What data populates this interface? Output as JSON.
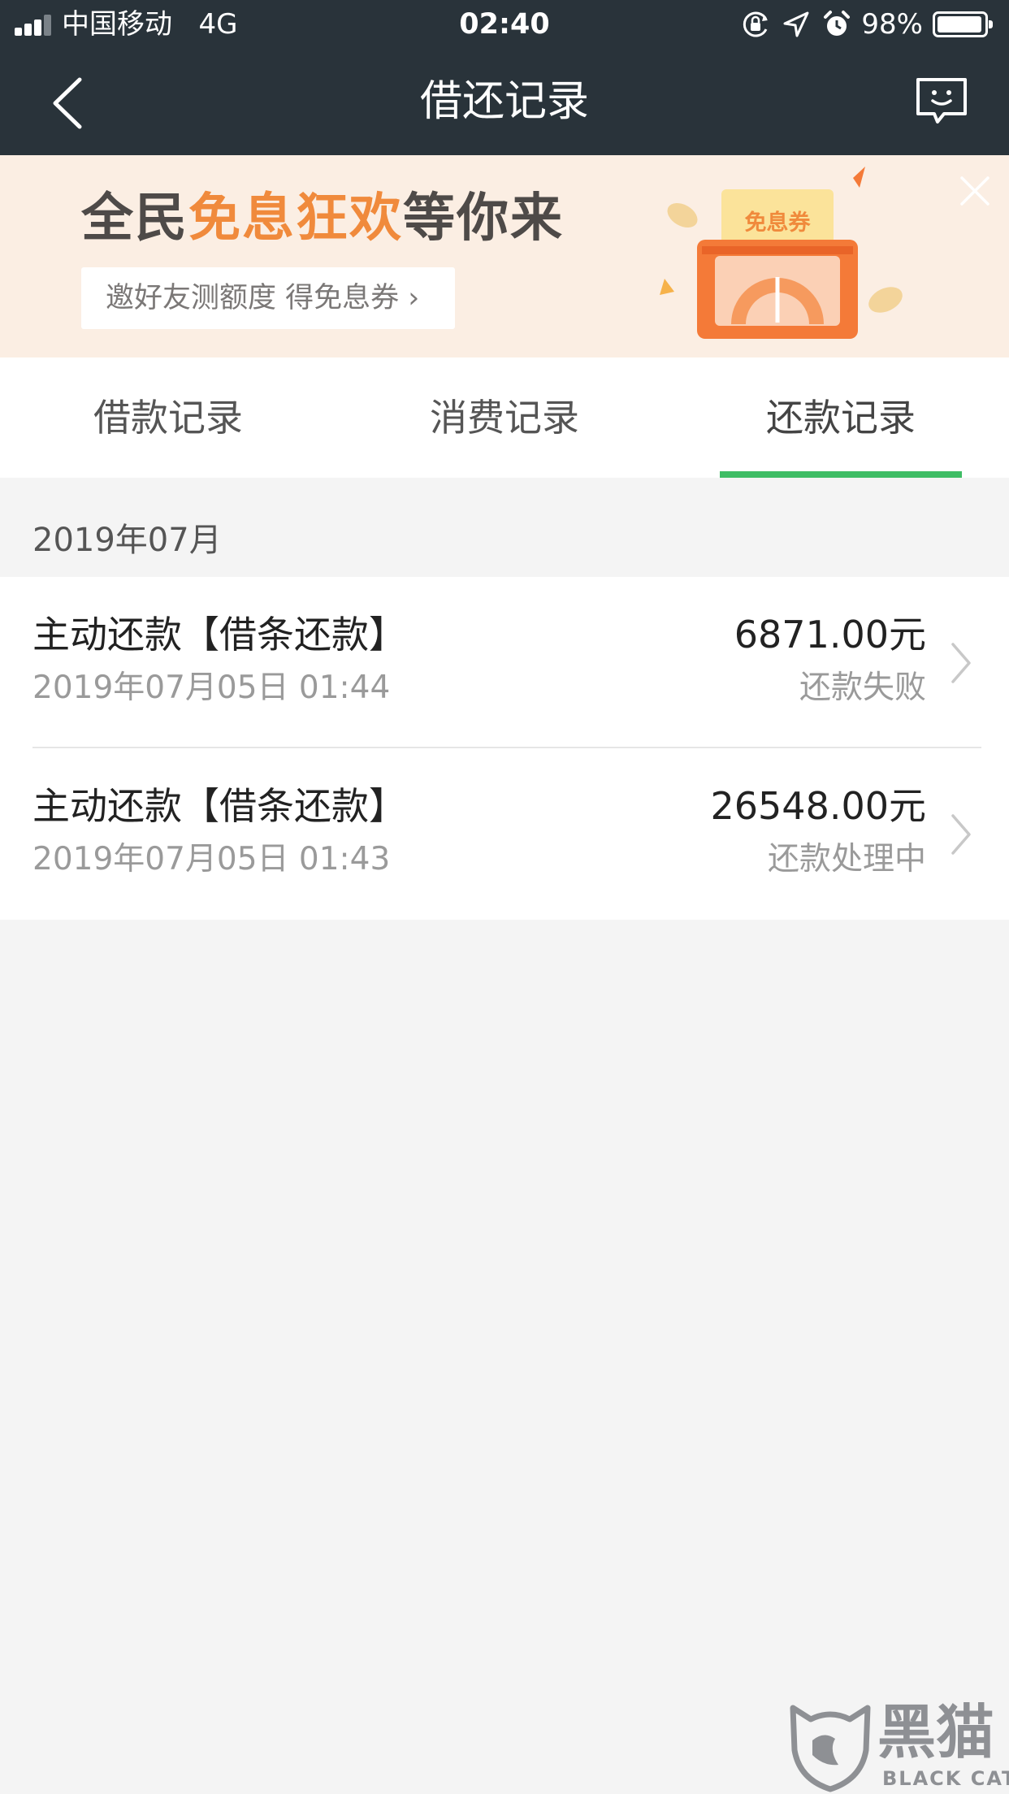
{
  "status_bar": {
    "carrier": "中国移动",
    "network": "4G",
    "time": "02:40",
    "battery_percent": "98%",
    "battery_level": 0.98,
    "icons": [
      "signal-icon",
      "orientation-lock-icon",
      "location-icon",
      "alarm-icon",
      "battery-icon"
    ]
  },
  "navbar": {
    "title": "借还记录",
    "back_icon": "chevron-left-icon",
    "feedback_icon": "chat-feedback-icon"
  },
  "banner": {
    "headline_part1": "全民",
    "headline_highlight": "免息狂欢",
    "headline_part2": "等你来",
    "cta": "邀好友测额度 得免息券 ›",
    "coupon_label": "免息券",
    "close_icon": "close-icon",
    "colors": {
      "background": "#fbeee3",
      "highlight": "#f08a3c",
      "art": "#f47a38"
    }
  },
  "tabs": [
    {
      "label": "借款记录",
      "active": false
    },
    {
      "label": "消费记录",
      "active": false
    },
    {
      "label": "还款记录",
      "active": true
    }
  ],
  "accent_color": "#3fbd65",
  "records": {
    "month": "2019年07月",
    "items": [
      {
        "title": "主动还款【借条还款】",
        "time": "2019年07月05日 01:44",
        "amount": "6871.00元",
        "status": "还款失败"
      },
      {
        "title": "主动还款【借条还款】",
        "time": "2019年07月05日 01:43",
        "amount": "26548.00元",
        "status": "还款处理中"
      }
    ]
  },
  "watermark": {
    "name": "黑猫",
    "sub": "BLACK CAT"
  }
}
